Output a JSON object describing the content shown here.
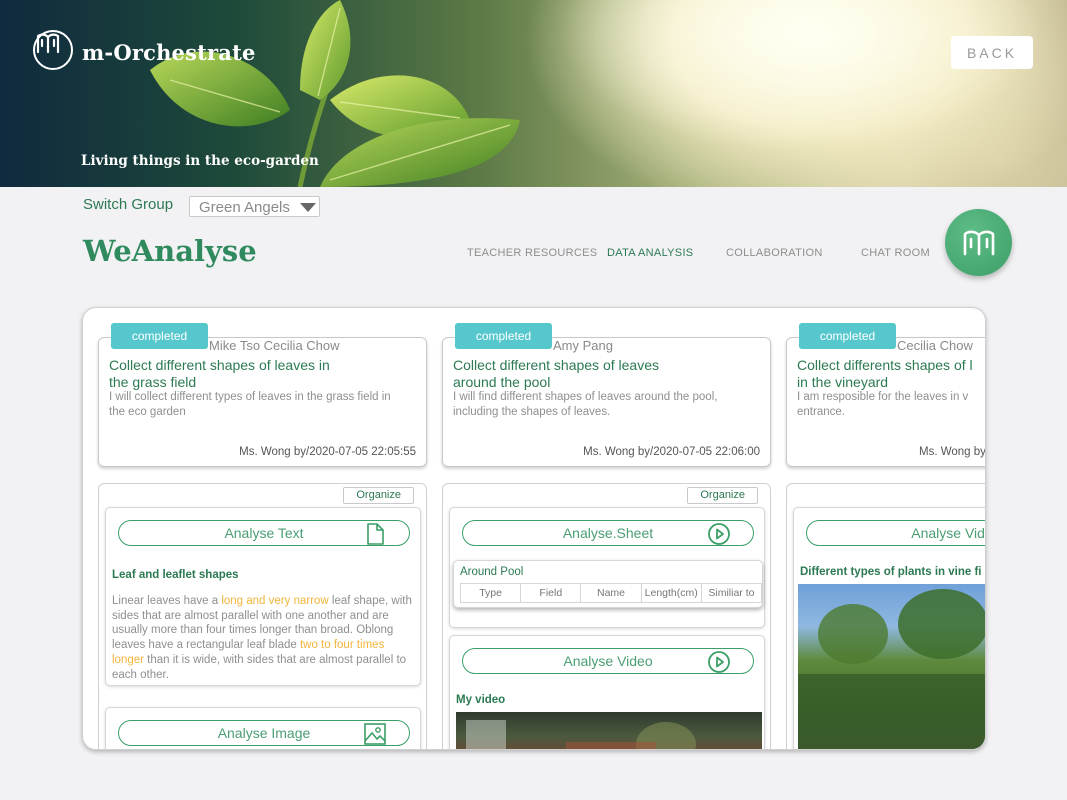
{
  "header": {
    "brand": "m-Orchestrate",
    "subtitle": "Living things in the eco-garden",
    "back_label": "BACK"
  },
  "group": {
    "switch_label": "Switch Group",
    "selected": "Green Angels"
  },
  "page_title": "WeAnalyse",
  "nav": [
    "TEACHER RESOURCES",
    "DATA ANALYSIS",
    "COLLABORATION",
    "CHAT ROOM"
  ],
  "nav_active": "DATA ANALYSIS",
  "columns": [
    {
      "status": "completed",
      "members": "Mike Tso Cecilia Chow",
      "title_line1": "Collect different shapes of leaves in",
      "title_line2": "the grass field",
      "description": "I will collect different types of leaves in the grass field in the eco garden",
      "meta": "Ms. Wong by/2020-07-05 22:05:55",
      "organize": "Organize",
      "items": [
        {
          "button": "Analyse Text",
          "heading": "Leaf and leaflet shapes",
          "body_parts": [
            "Linear leaves have a ",
            "long and very narrow",
            " leaf shape, with sides that are almost parallel with one another and are usually more than four times longer than broad. Oblong leaves have a rectangular leaf blade ",
            "two to four times longer",
            " than it is wide, with sides that are almost parallel to each other."
          ]
        },
        {
          "button": "Analyse Image"
        }
      ]
    },
    {
      "status": "completed",
      "members": "Amy Pang",
      "title_line1": "Collect different shapes of leaves",
      "title_line2": "around the pool",
      "description": "I will find different shapes of leaves around the pool, including the shapes of leaves.",
      "meta": "Ms. Wong by/2020-07-05 22:06:00",
      "organize": "Organize",
      "items": [
        {
          "button": "Analyse.Sheet",
          "heading": "Around Pool",
          "columns": [
            "Type",
            "Field",
            "Name",
            "Length(cm)",
            "Similiar to"
          ]
        },
        {
          "button": "Analyse Video",
          "heading": "My video"
        }
      ]
    },
    {
      "status": "completed",
      "members": "Cecilia Chow",
      "title_line1": "Collect differents shapes of l",
      "title_line2": "in the vineyard",
      "description": "I am resposible for the leaves in v entrance.",
      "meta": "Ms. Wong by",
      "items": [
        {
          "button": "Analyse Vide",
          "heading": "Different types of plants in vine fi"
        }
      ]
    }
  ],
  "colors": {
    "accent": "#2c7a52",
    "badge": "#56c7cc",
    "highlight": "#f2b43b"
  }
}
